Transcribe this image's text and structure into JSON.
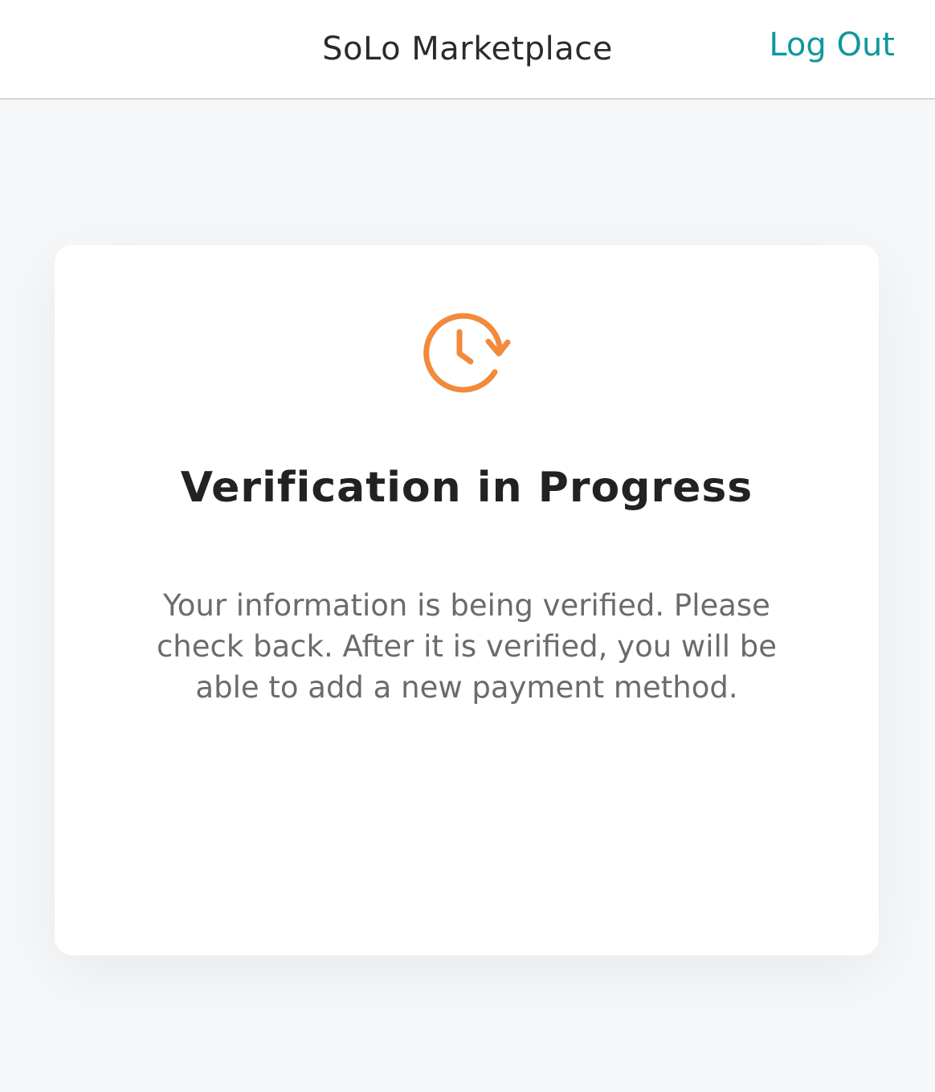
{
  "header": {
    "title": "SoLo Marketplace",
    "logout_label": "Log Out"
  },
  "card": {
    "icon": "clock-refresh-icon",
    "title": "Verification in Progress",
    "message": "Your information is being verified. Please check back. After it is verified, you will be able to add a new payment method."
  },
  "colors": {
    "accent": "#10979c",
    "icon_orange": "#f28a3c",
    "title_text": "#222222",
    "body_text": "#6b6b6b",
    "background": "#f6f7f9"
  }
}
